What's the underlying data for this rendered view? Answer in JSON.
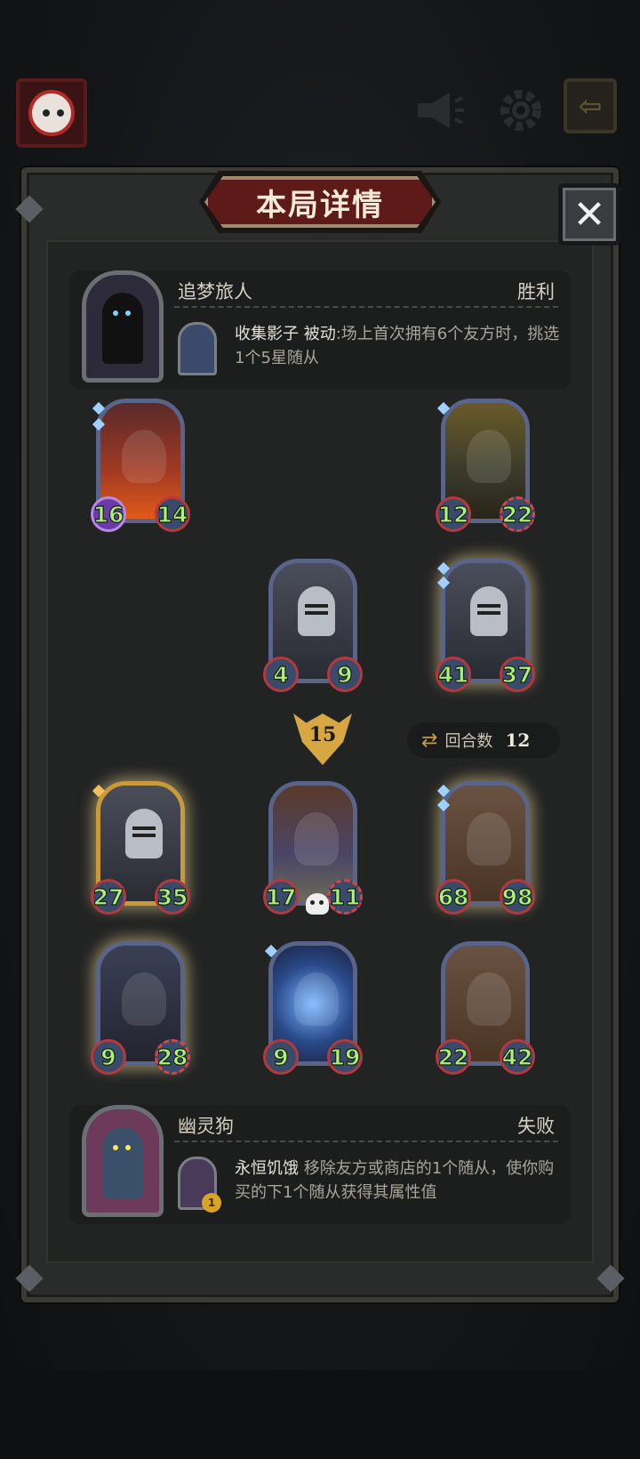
{
  "panel": {
    "title": "本局详情",
    "close_symbol": "✕"
  },
  "topbar": {
    "exit_symbol": "⇦"
  },
  "players": {
    "top": {
      "name": "追梦旅人",
      "result": "胜利",
      "skill_name": "收集影子",
      "skill_tag": "被动",
      "skill_desc": ":场上首次拥有6个友方时，挑选1个5星随从"
    },
    "bottom": {
      "name": "幽灵狗",
      "result": "失败",
      "skill_name": "永恒饥饿",
      "skill_desc": " 移除友方或商店的1个随从，使你购买的下1个随从获得其属性值",
      "skill_badge": "1"
    }
  },
  "top_board": [
    {
      "art": "dragon",
      "attack": "16",
      "health": "14"
    },
    {
      "art": "hunter",
      "attack": "12",
      "health": "22"
    },
    {
      "art": "knight",
      "attack": "4",
      "health": "9"
    },
    {
      "art": "knight",
      "attack": "41",
      "health": "37"
    }
  ],
  "combat": {
    "damage": "15",
    "round_label": "回合数",
    "round_value": "12"
  },
  "bottom_board": [
    {
      "art": "knight",
      "attack": "27",
      "health": "35"
    },
    {
      "art": "owl",
      "attack": "17",
      "health": "11"
    },
    {
      "art": "brute",
      "attack": "68",
      "health": "98"
    },
    {
      "art": "gargoyle",
      "attack": "9",
      "health": "28"
    },
    {
      "art": "crystal",
      "attack": "9",
      "health": "19"
    },
    {
      "art": "brute",
      "attack": "22",
      "health": "42"
    }
  ]
}
